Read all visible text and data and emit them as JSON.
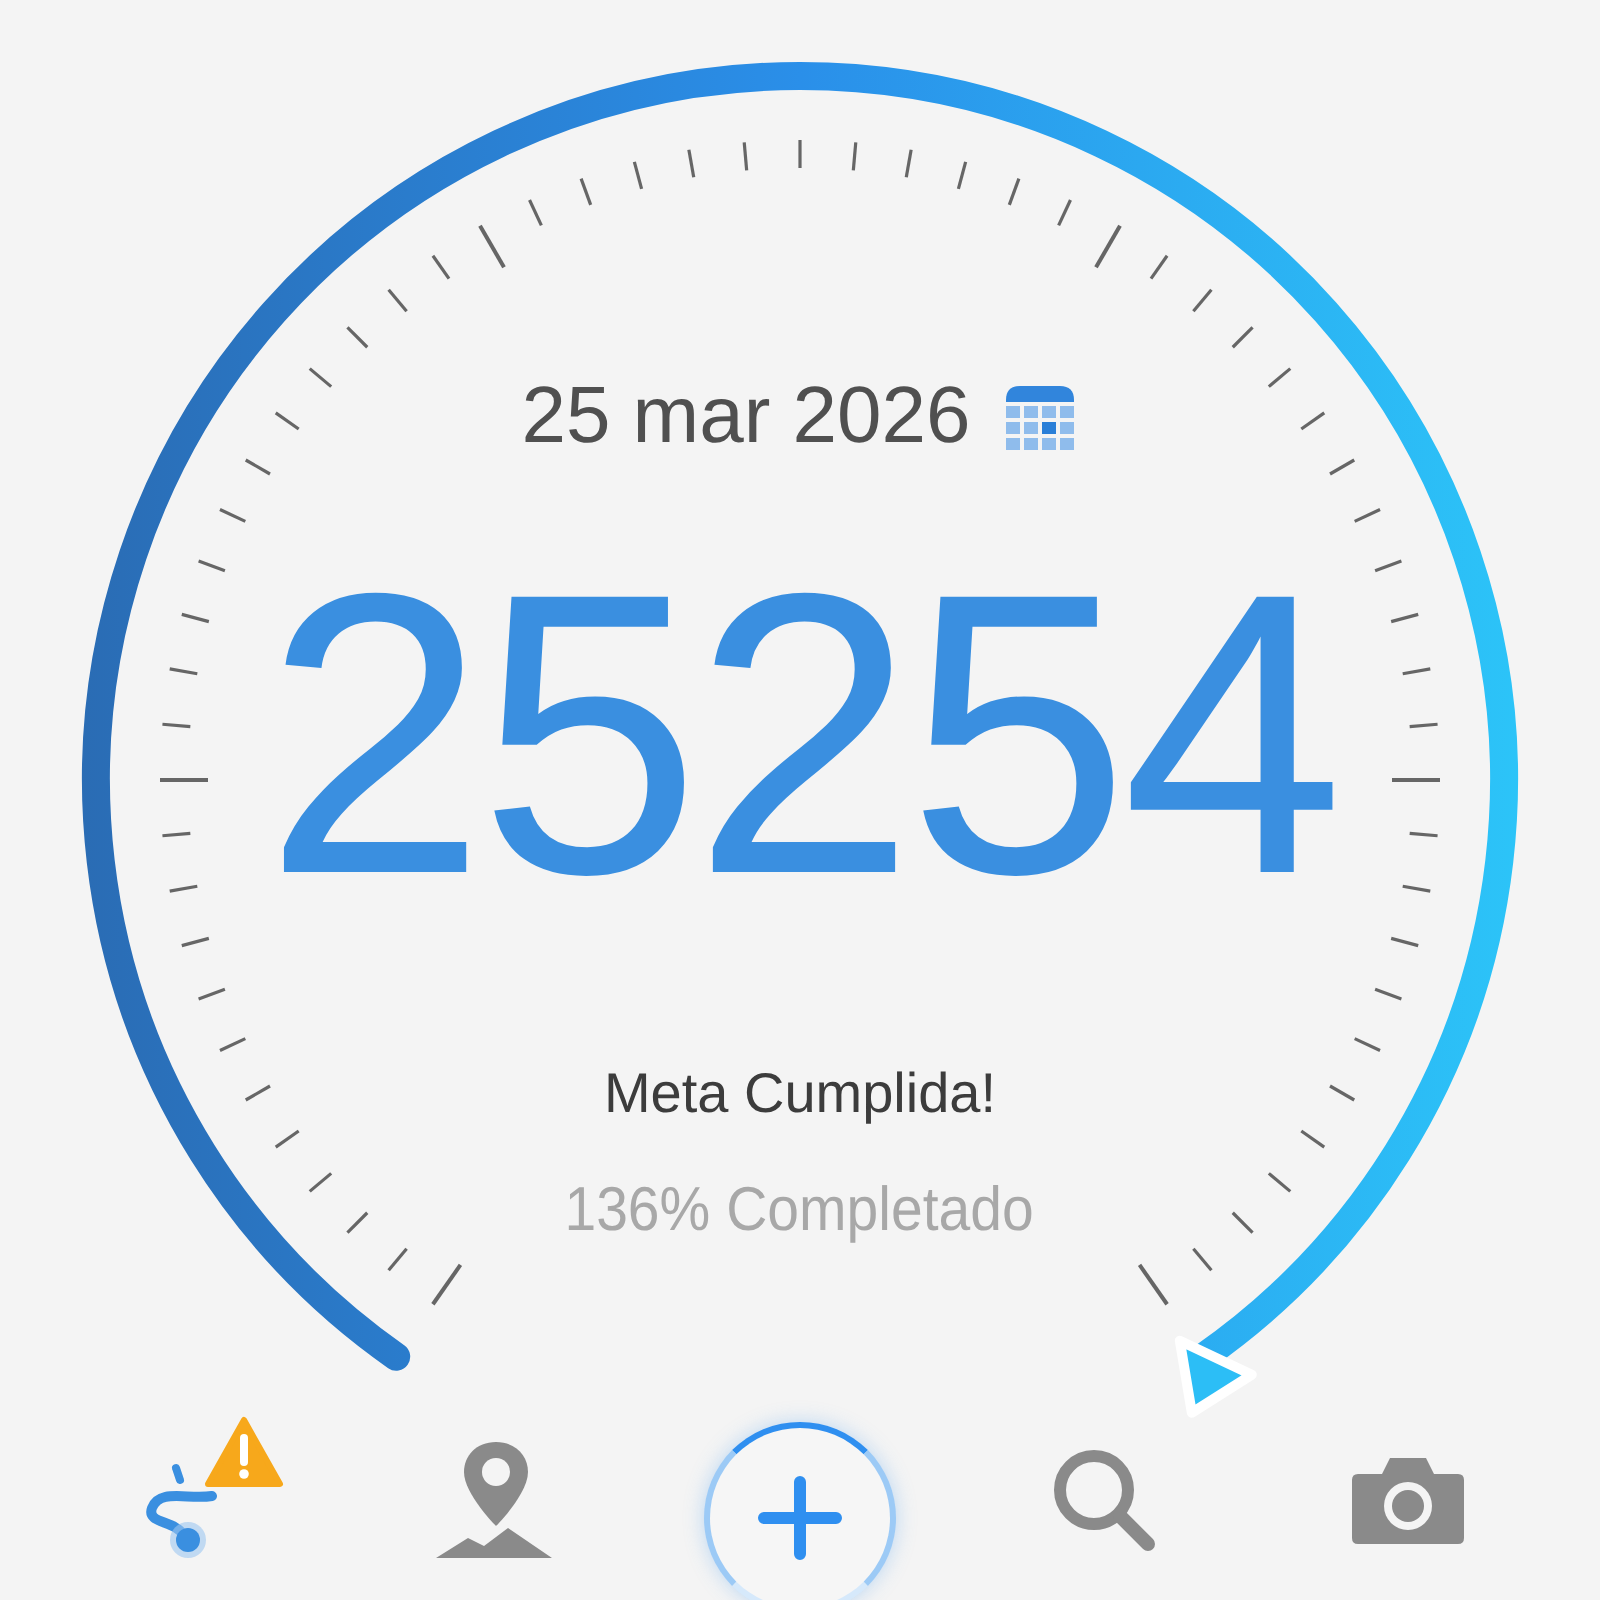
{
  "date": "25 mar 2026",
  "steps": "25254",
  "status": "Meta Cumplida!",
  "progress_text": "136% Completado",
  "nav": [
    {
      "kind": "route",
      "selected": true,
      "warning": true
    },
    {
      "kind": "map",
      "selected": false,
      "warning": false
    },
    {
      "kind": "add",
      "selected": false,
      "warning": false
    },
    {
      "kind": "search",
      "selected": false,
      "warning": false
    },
    {
      "kind": "camera",
      "selected": false,
      "warning": false
    }
  ]
}
